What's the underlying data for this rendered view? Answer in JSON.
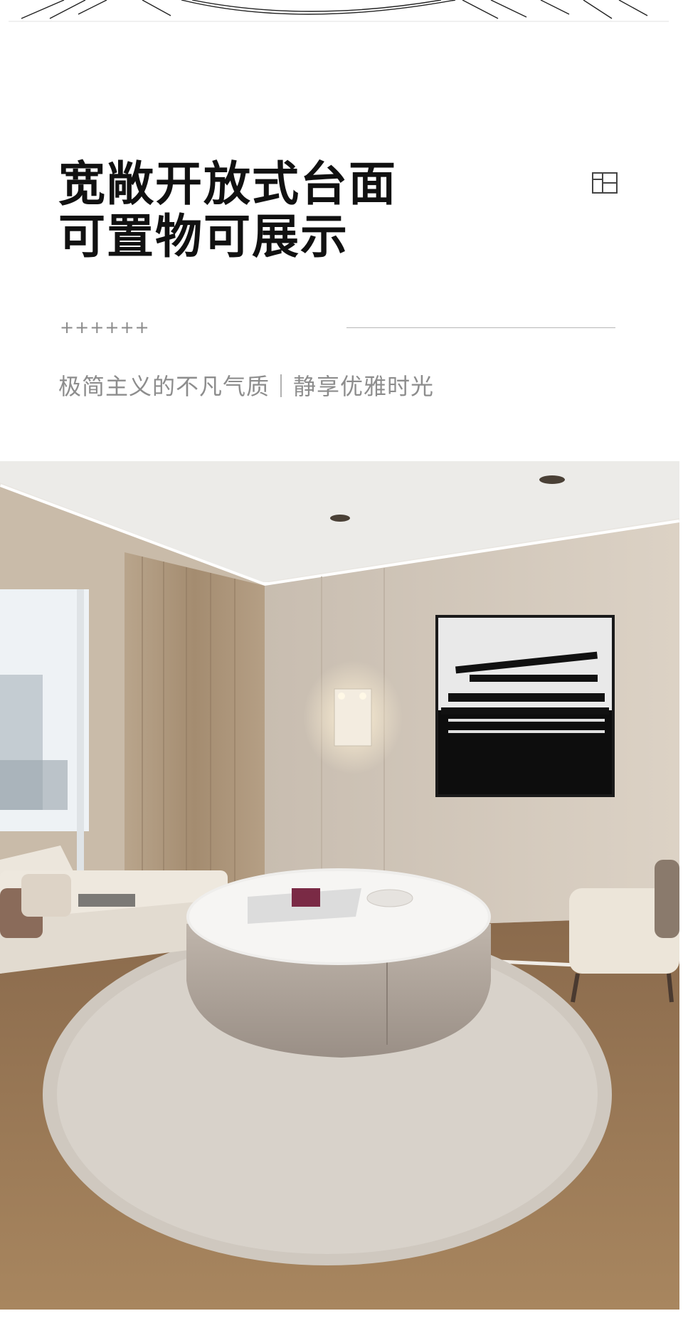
{
  "headline": {
    "line1": "宽敞开放式台面",
    "line2": "可置物可展示"
  },
  "decor": {
    "plus_marks": "++++++"
  },
  "tagline": "极简主义的不凡气质｜静享优雅时光",
  "icons": {
    "layout": "layout-panels-icon"
  },
  "colors": {
    "headline": "#111111",
    "subtext": "#8d8d8d",
    "wall": "#d8cfc2",
    "floor": "#a07e5b"
  }
}
